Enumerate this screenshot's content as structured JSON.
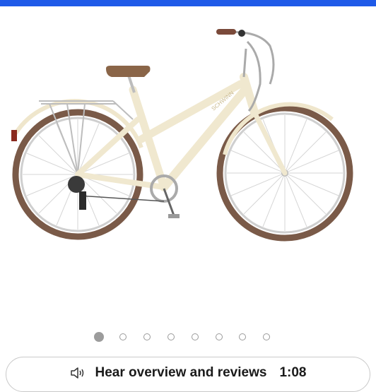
{
  "header": {
    "accent_color": "#1f5ae8"
  },
  "product": {
    "image_icon": "bicycle-image",
    "frame_brand": "SCHWINN",
    "colors": {
      "frame": "#f0e8cf",
      "tires": "#7a5a48",
      "saddle": "#8a6548",
      "metal": "#b8b8b8"
    }
  },
  "carousel": {
    "count": 8,
    "active_index": 0
  },
  "audio": {
    "icon": "speaker-icon",
    "label": "Hear overview and reviews",
    "duration": "1:08"
  }
}
